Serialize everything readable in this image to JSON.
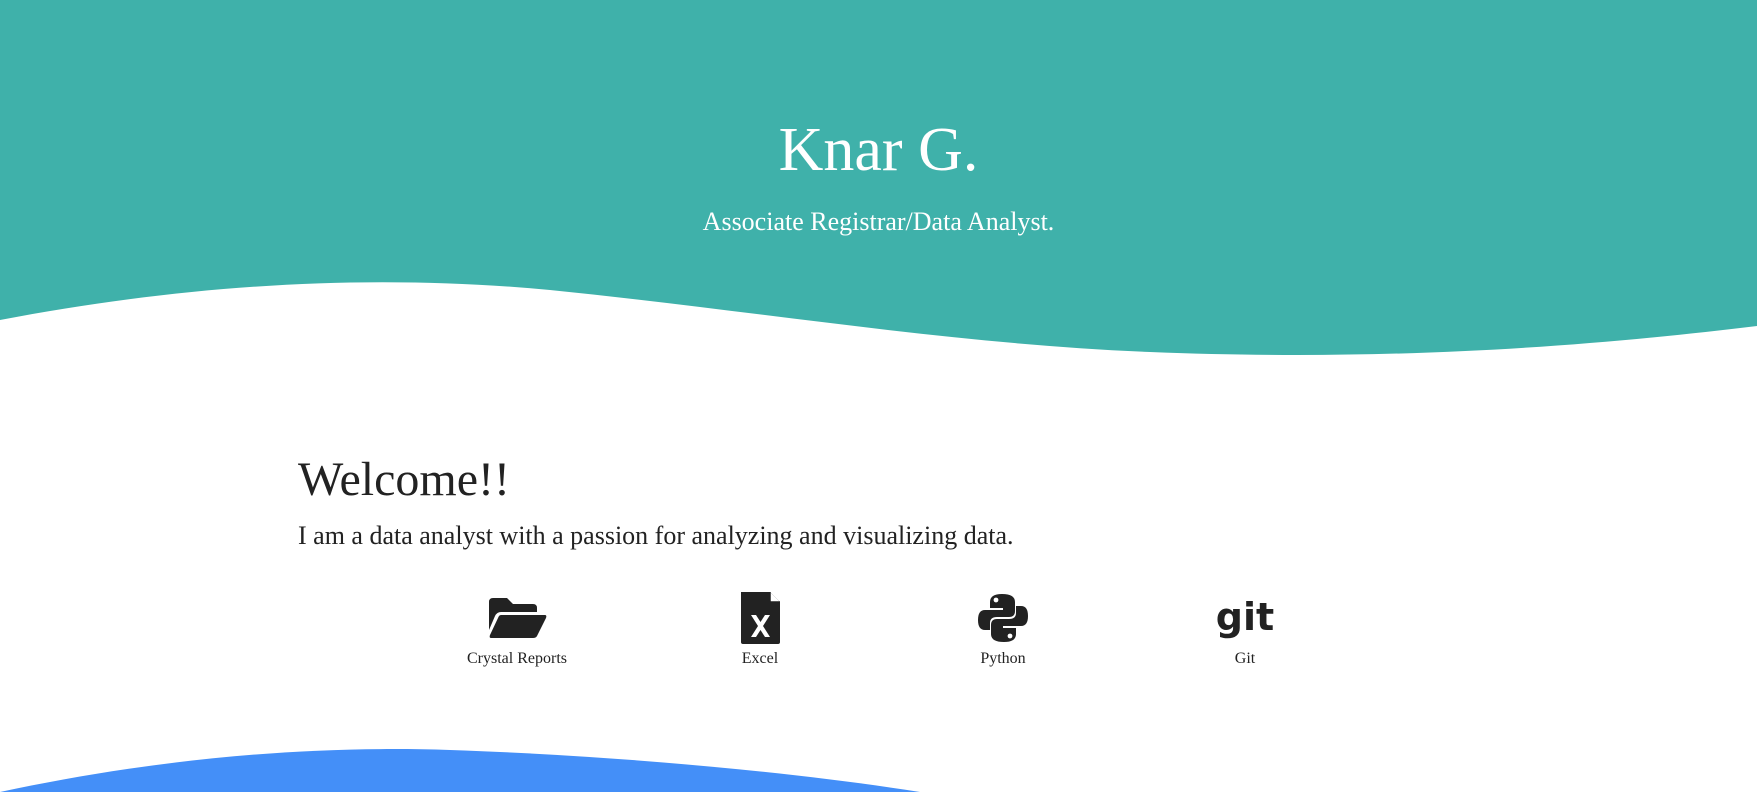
{
  "colors": {
    "hero_bg": "#3fb1aa",
    "bottom_wave": "#448ff8",
    "text": "#222222"
  },
  "hero": {
    "name": "Knar G.",
    "role": "Associate Registrar/Data Analyst."
  },
  "main": {
    "heading": "Welcome!!",
    "intro": "I am a data analyst with a passion for analyzing and visualizing data."
  },
  "skills": [
    {
      "icon": "folder-open-icon",
      "label": "Crystal Reports"
    },
    {
      "icon": "file-excel-icon",
      "label": "Excel"
    },
    {
      "icon": "python-icon",
      "label": "Python"
    },
    {
      "icon": "git-icon",
      "label": "Git"
    }
  ]
}
